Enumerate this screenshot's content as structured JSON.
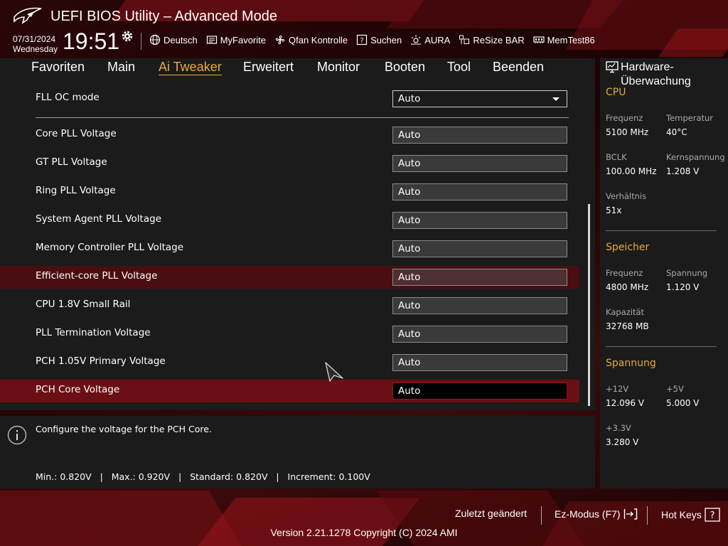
{
  "header": {
    "title": "UEFI BIOS Utility – Advanced Mode",
    "date": "07/31/2024",
    "weekday": "Wednesday",
    "time": "19:51",
    "toolbar": {
      "language": "Deutsch",
      "myfavorite": "MyFavorite",
      "qfan": "Qfan Kontrolle",
      "search": "Suchen",
      "aura": "AURA",
      "resizebar": "ReSize BAR",
      "memtest": "MemTest86"
    }
  },
  "tabs": [
    {
      "label": "Favoriten"
    },
    {
      "label": "Main"
    },
    {
      "label": "Ai Tweaker",
      "active": true
    },
    {
      "label": "Erweitert"
    },
    {
      "label": "Monitor"
    },
    {
      "label": "Booten"
    },
    {
      "label": "Tool"
    },
    {
      "label": "Beenden"
    }
  ],
  "settings": {
    "fll_oc_mode": {
      "label": "FLL OC mode",
      "value": "Auto"
    },
    "rows": [
      {
        "label": "Core PLL Voltage",
        "value": "Auto"
      },
      {
        "label": "GT PLL Voltage",
        "value": "Auto"
      },
      {
        "label": "Ring PLL Voltage",
        "value": "Auto"
      },
      {
        "label": "System Agent PLL Voltage",
        "value": "Auto"
      },
      {
        "label": "Memory Controller PLL Voltage",
        "value": "Auto"
      },
      {
        "label": "Efficient-core PLL Voltage",
        "value": "Auto",
        "state": "hover"
      },
      {
        "label": "CPU 1.8V Small Rail",
        "value": "Auto"
      },
      {
        "label": "PLL Termination Voltage",
        "value": "Auto"
      },
      {
        "label": "PCH 1.05V Primary Voltage",
        "value": "Auto"
      },
      {
        "label": "PCH Core Voltage",
        "value": "Auto",
        "state": "selected"
      }
    ]
  },
  "help": {
    "description": "Configure the voltage for the PCH Core.",
    "range": "Min.: 0.820V   |   Max.: 0.920V   |   Standard: 0.820V   |   Increment: 0.100V"
  },
  "hardware_monitor": {
    "title": "Hardware-Überwachung",
    "cpu": {
      "heading": "CPU",
      "freq_label": "Frequenz",
      "freq": "5100 MHz",
      "temp_label": "Temperatur",
      "temp": "40°C",
      "bclk_label": "BCLK",
      "bclk": "100.00 MHz",
      "core_v_label": "Kernspannung",
      "core_v": "1.208 V",
      "ratio_label": "Verhältnis",
      "ratio": "51x"
    },
    "memory": {
      "heading": "Speicher",
      "freq_label": "Frequenz",
      "freq": "4800 MHz",
      "volt_label": "Spannung",
      "volt": "1.120 V",
      "cap_label": "Kapazität",
      "cap": "32768 MB"
    },
    "voltage": {
      "heading": "Spannung",
      "v12_label": "+12V",
      "v12": "12.096 V",
      "v5_label": "+5V",
      "v5": "5.000 V",
      "v33_label": "+3.3V",
      "v33": "3.280 V"
    }
  },
  "footer": {
    "last_modified": "Zuletzt geändert",
    "ez_mode": "Ez-Modus (F7)",
    "hot_keys": "Hot Keys",
    "version": "Version 2.21.1278 Copyright (C) 2024 AMI"
  },
  "colors": {
    "accent": "#e8a93a",
    "selected_row": "#6a0f14",
    "hover_row": "#4a0e12",
    "panel": "#1b1b1b"
  }
}
